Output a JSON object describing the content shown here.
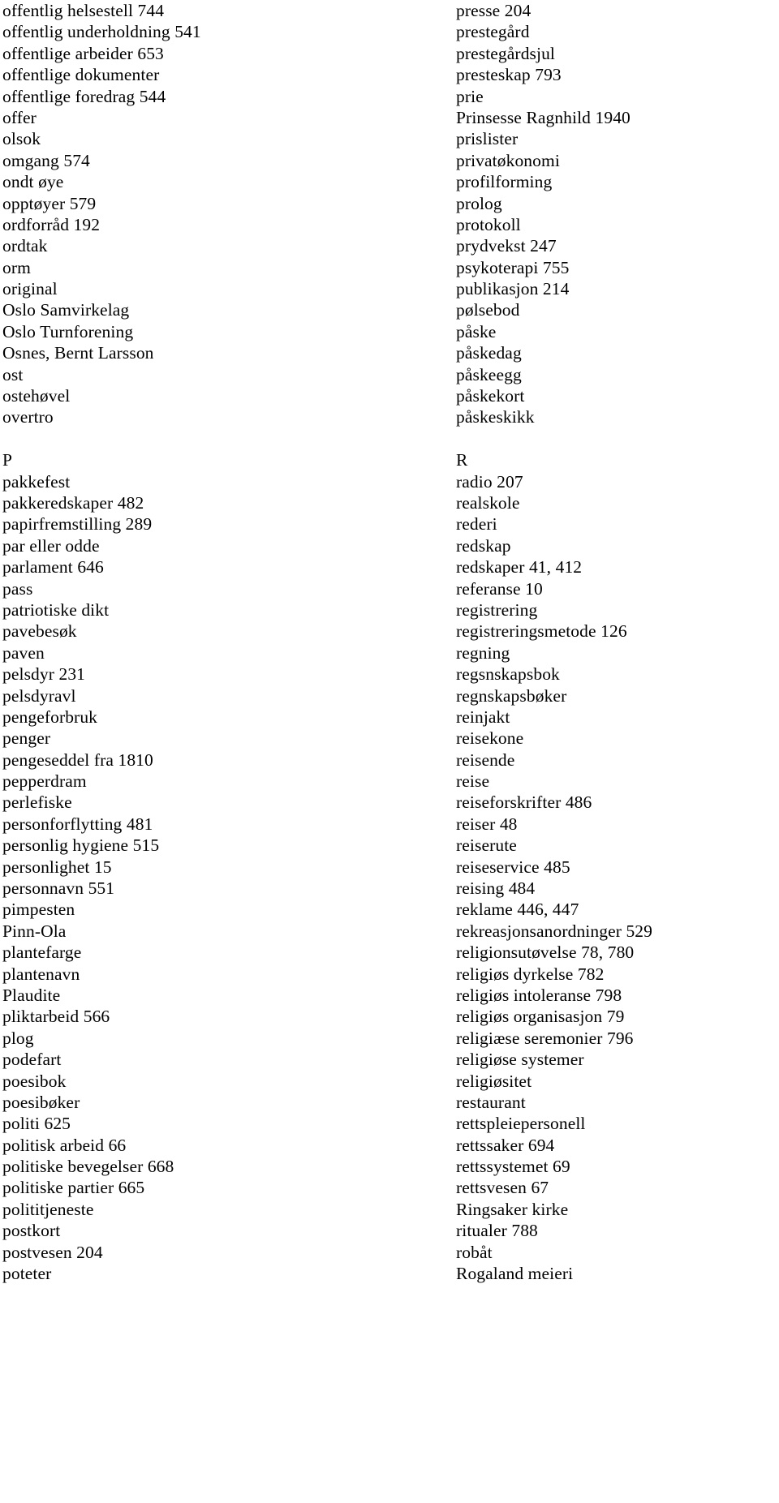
{
  "document": {
    "type": "book-index",
    "language": "Norwegian",
    "background_color": "#ffffff",
    "text_color": "#000000",
    "columns": 2
  },
  "columns": {
    "left": {
      "blocks": [
        {
          "kind": "entries",
          "items": [
            "offentlig helsestell 744",
            "offentlig underholdning 541",
            "offentlige arbeider 653",
            "offentlige dokumenter",
            "offentlige foredrag 544",
            "offer",
            "olsok",
            "omgang 574",
            "ondt øye",
            "opptøyer 579",
            "ordforråd 192",
            "ordtak",
            "orm",
            "original",
            "Oslo Samvirkelag",
            "Oslo Turnforening",
            "Osnes, Bernt Larsson",
            "ost",
            "ostehøvel",
            "overtro"
          ]
        },
        {
          "kind": "spacer"
        },
        {
          "kind": "heading",
          "label": "P"
        },
        {
          "kind": "entries",
          "items": [
            "pakkefest",
            "pakkeredskaper 482",
            "papirfremstilling 289",
            "par eller odde",
            "parlament 646",
            "pass",
            "patriotiske dikt",
            "pavebesøk",
            "paven",
            "pelsdyr 231",
            "pelsdyravl",
            "pengeforbruk",
            "penger",
            "pengeseddel fra 1810",
            "pepperdram",
            "perlefiske",
            "personforflytting 481",
            "personlig hygiene 515",
            "personlighet 15",
            "personnavn 551",
            "pimpesten",
            "Pinn-Ola",
            "plantefarge",
            "plantenavn",
            "Plaudite",
            "pliktarbeid 566",
            "plog",
            "podefart",
            "poesibok",
            "poesibøker",
            "politi 625",
            "politisk arbeid 66",
            "politiske bevegelser 668",
            "politiske partier 665",
            "polititjeneste",
            "postkort",
            "postvesen 204",
            "poteter"
          ]
        }
      ]
    },
    "right": {
      "blocks": [
        {
          "kind": "entries",
          "items": [
            "presse 204",
            "prestegård",
            "prestegårdsjul",
            "presteskap 793",
            "prie",
            "Prinsesse Ragnhild 1940",
            "prislister",
            "privatøkonomi",
            "profilforming",
            "prolog",
            "protokoll",
            "prydvekst 247",
            "psykoterapi 755",
            "publikasjon 214",
            "pølsebod",
            "påske",
            "påskedag",
            "påskeegg",
            "påskekort",
            "påskeskikk"
          ]
        },
        {
          "kind": "spacer"
        },
        {
          "kind": "heading",
          "label": "R"
        },
        {
          "kind": "entries",
          "items": [
            "radio 207",
            "realskole",
            "rederi",
            "redskap",
            "redskaper 41, 412",
            "referanse 10",
            "registrering",
            "registreringsmetode 126",
            "regning",
            "regsnskapsbok",
            "regnskapsbøker",
            "reinjakt",
            "reisekone",
            "reisende",
            "reise",
            "reiseforskrifter 486",
            "reiser 48",
            "reiserute",
            "reiseservice 485",
            "reising 484",
            "reklame 446, 447",
            "rekreasjonsanordninger 529",
            "religionsutøvelse 78, 780",
            "religiøs dyrkelse 782",
            "religiøs intoleranse 798",
            "religiøs organisasjon 79",
            "religiæse seremonier 796",
            "religiøse systemer",
            "religiøsitet",
            "restaurant",
            "rettspleiepersonell",
            "rettssaker 694",
            "rettssystemet 69",
            "rettsvesen 67",
            "Ringsaker kirke",
            "ritualer 788",
            "robåt",
            "Rogaland meieri"
          ]
        }
      ]
    }
  }
}
